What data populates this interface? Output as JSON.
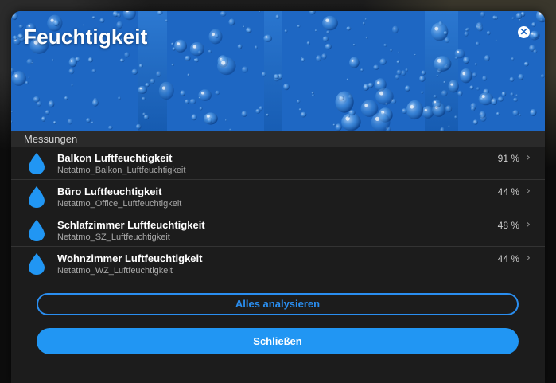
{
  "dialog": {
    "title": "Feuchtigkeit",
    "close_icon": "close-icon",
    "header_image": "water-droplets-background"
  },
  "section": {
    "title": "Messungen"
  },
  "sensors": [
    {
      "name": "Balkon Luftfeuchtigkeit",
      "entity": "Netatmo_Balkon_Luftfeuchtigkeit",
      "value": "91 %",
      "icon": "water-drop-icon"
    },
    {
      "name": "Büro Luftfeuchtigkeit",
      "entity": "Netatmo_Office_Luftfeuchtigkeit",
      "value": "44 %",
      "icon": "water-drop-icon"
    },
    {
      "name": "Schlafzimmer Luftfeuchtigkeit",
      "entity": "Netatmo_SZ_Luftfeuchtigkeit",
      "value": "48 %",
      "icon": "water-drop-icon"
    },
    {
      "name": "Wohnzimmer Luftfeuchtigkeit",
      "entity": "Netatmo_WZ_Luftfeuchtigkeit",
      "value": "44 %",
      "icon": "water-drop-icon"
    }
  ],
  "actions": {
    "analyze_label": "Alles analysieren",
    "close_label": "Schließen"
  },
  "colors": {
    "accent": "#2196f3",
    "drop_icon": "#2196f3",
    "background": "#1c1c1c"
  }
}
